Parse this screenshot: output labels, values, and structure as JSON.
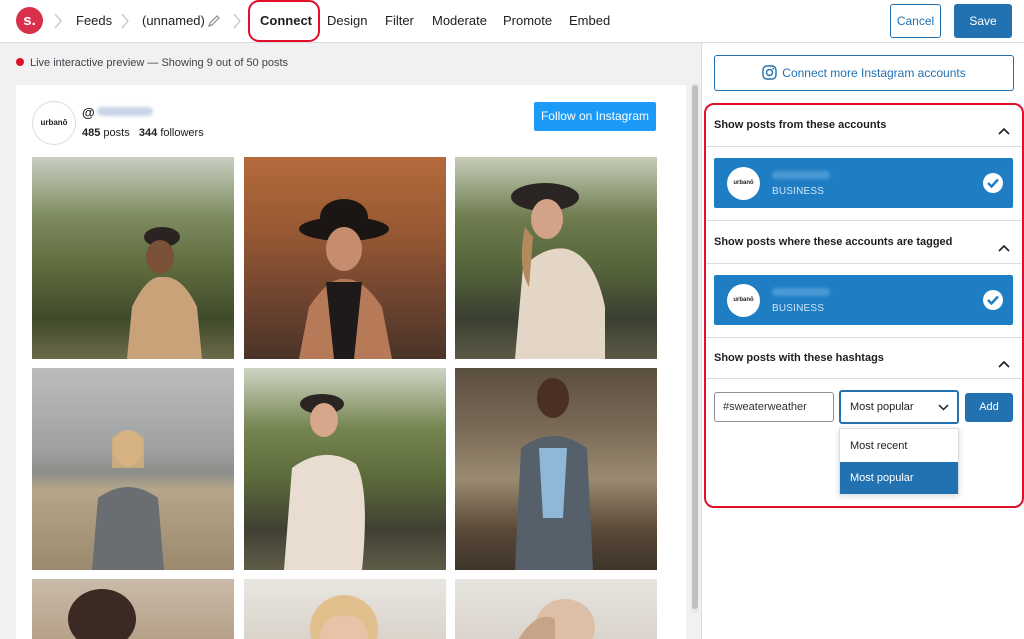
{
  "topbar": {
    "logo_letter": "s.",
    "nav": {
      "feeds": "Feeds",
      "unnamed": "(unnamed)",
      "connect": "Connect",
      "design": "Design",
      "filter": "Filter",
      "moderate": "Moderate",
      "promote": "Promote",
      "embed": "Embed"
    },
    "cancel_label": "Cancel",
    "save_label": "Save"
  },
  "preview": {
    "status_text": "Live interactive preview — Showing 9 out of 50 posts",
    "profile": {
      "logo_text": "urbanō",
      "handle_prefix": "@",
      "posts_count": "485",
      "posts_label": "posts",
      "followers_count": "344",
      "followers_label": "followers"
    },
    "follow_label": "Follow on Instagram"
  },
  "sidebar": {
    "connect_more_label": "Connect more Instagram accounts",
    "section_accounts": "Show posts from these accounts",
    "section_tagged": "Show posts where these accounts are tagged",
    "section_hashtags": "Show posts with these hashtags",
    "account_logo_text": "urbanō",
    "account_type": "BUSINESS",
    "hashtag_value": "#sweaterweather",
    "sort_selected": "Most popular",
    "add_label": "Add",
    "sort_options": [
      "Most recent",
      "Most popular"
    ]
  },
  "colors": {
    "accent": "#2271b1",
    "brand": "#d8304a",
    "highlight": "#e0102a",
    "account_card": "#1f7dc4",
    "follow_button": "#1b9af7"
  }
}
